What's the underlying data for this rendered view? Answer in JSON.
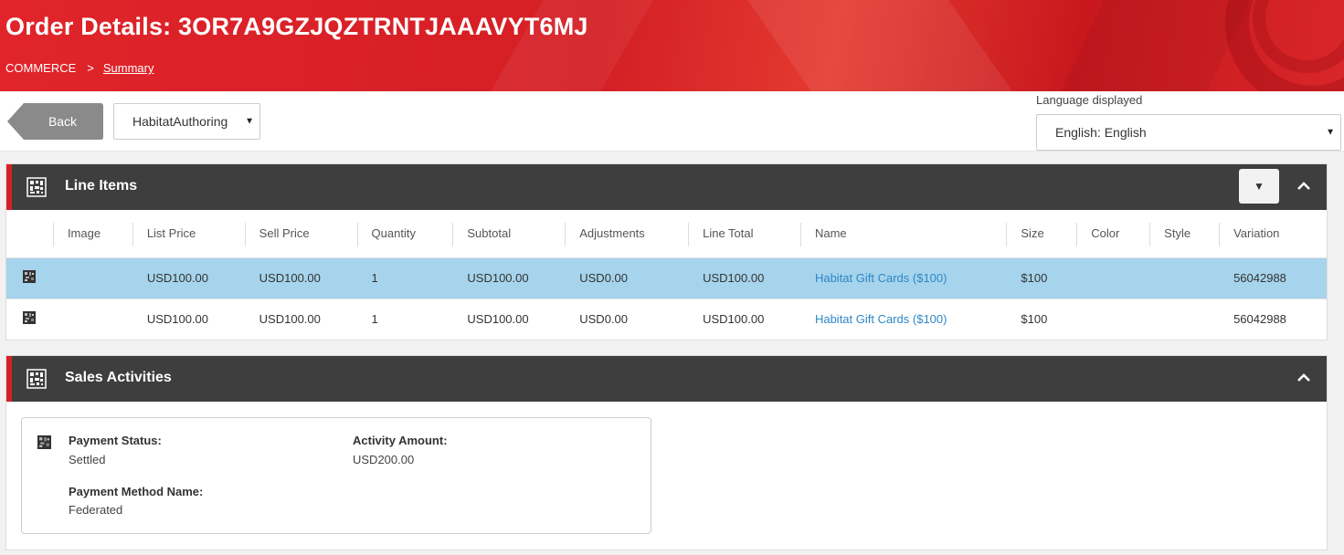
{
  "header": {
    "title": "Order Details: 3OR7A9GZJQZTRNTJAAAVYT6MJ",
    "breadcrumb": {
      "root": "COMMERCE",
      "separator": ">",
      "current": "Summary"
    }
  },
  "toolbar": {
    "back_label": "Back",
    "environment_select": "HabitatAuthoring",
    "language_label": "Language displayed",
    "language_select": "English: English"
  },
  "line_items": {
    "title": "Line Items",
    "columns": [
      "Image",
      "List Price",
      "Sell Price",
      "Quantity",
      "Subtotal",
      "Adjustments",
      "Line Total",
      "Name",
      "Size",
      "Color",
      "Style",
      "Variation"
    ],
    "rows": [
      {
        "selected": true,
        "list_price": "USD100.00",
        "sell_price": "USD100.00",
        "quantity": "1",
        "subtotal": "USD100.00",
        "adjustments": "USD0.00",
        "line_total": "USD100.00",
        "name": "Habitat Gift Cards ($100)",
        "size": "$100",
        "color": "",
        "style": "",
        "variation": "56042988"
      },
      {
        "selected": false,
        "list_price": "USD100.00",
        "sell_price": "USD100.00",
        "quantity": "1",
        "subtotal": "USD100.00",
        "adjustments": "USD0.00",
        "line_total": "USD100.00",
        "name": "Habitat Gift Cards ($100)",
        "size": "$100",
        "color": "",
        "style": "",
        "variation": "56042988"
      }
    ]
  },
  "sales_activities": {
    "title": "Sales Activities",
    "payment_status_label": "Payment Status:",
    "payment_status_value": "Settled",
    "activity_amount_label": "Activity Amount:",
    "activity_amount_value": "USD200.00",
    "payment_method_label": "Payment Method Name:",
    "payment_method_value": "Federated"
  },
  "colors": {
    "header_red": "#d41f25",
    "panel_dark": "#3e3e3e",
    "accent_red": "#d42127",
    "selected_row": "#a6d4ec",
    "link_blue": "#2f86c6"
  },
  "icons": {
    "panel_icon": "grid-table-icon",
    "row_icon": "item-thumbnail-icon",
    "collapse": "chevron-up-icon",
    "filter": "caret-down-icon",
    "select_arrow": "caret-down-icon"
  }
}
